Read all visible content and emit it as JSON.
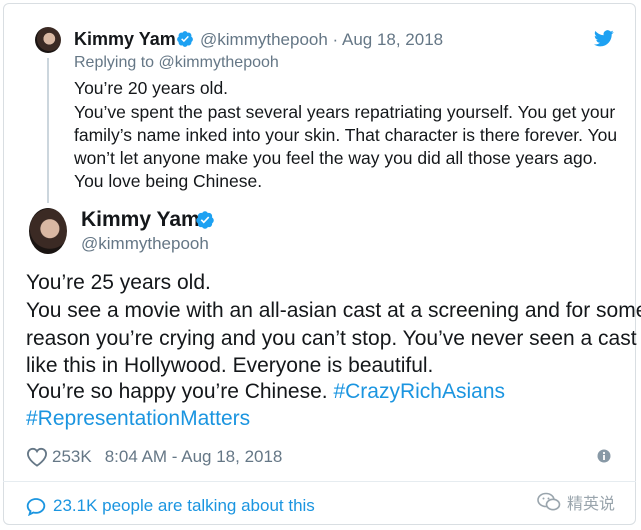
{
  "quoted": {
    "name": "Kimmy Yam",
    "handle_date": "@kimmythepooh · Aug 18, 2018",
    "replying_to": "Replying to @kimmythepooh",
    "lines": [
      "You’re 20 years old.",
      "You’ve spent the past several years repatriating yourself. You get your",
      "family’s name inked into your skin. That character is there forever. You",
      "won’t let anyone make you feel the way you did all those years ago.",
      "You love being Chinese."
    ]
  },
  "main": {
    "name": "Kimmy Yam",
    "handle": "@kimmythepooh",
    "lines": [
      "You’re 25 years old.",
      "You see a movie with an all-asian cast at a screening and for some",
      "reason you’re crying and you can’t stop. You’ve never seen a cast",
      "like this in Hollywood. Everyone is beautiful."
    ],
    "line5_text": "You’re so happy you’re Chinese. ",
    "hashtag1": "#CrazyRichAsians",
    "hashtag2": "#RepresentationMatters"
  },
  "meta": {
    "likes": "253K",
    "timestamp": "8:04 AM - Aug 18, 2018"
  },
  "footer": {
    "talking": "23.1K people are talking about this"
  },
  "watermark": {
    "text": "精英说"
  },
  "colors": {
    "link": "#1b95e0",
    "muted": "#657786",
    "verified": "#1da1f2"
  },
  "icons": [
    "verified-badge-icon",
    "twitter-bird-icon",
    "heart-icon",
    "info-icon",
    "speech-bubble-icon",
    "wechat-icon"
  ]
}
